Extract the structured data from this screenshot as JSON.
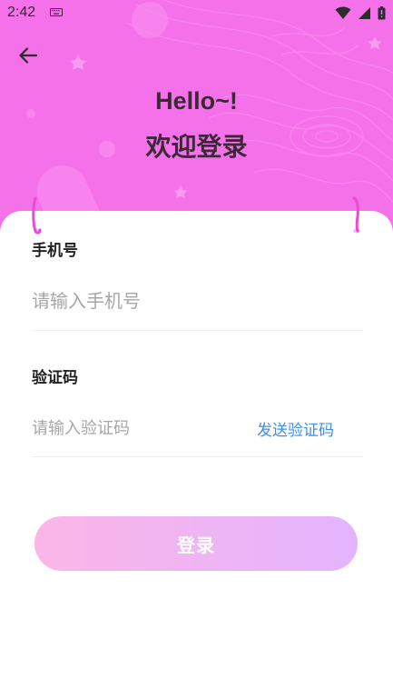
{
  "status_bar": {
    "time": "2:42"
  },
  "header": {
    "greeting": "Hello~!",
    "title": "欢迎登录",
    "back_icon": "arrow-left-icon"
  },
  "form": {
    "phone": {
      "label": "手机号",
      "placeholder": "请输入手机号",
      "value": ""
    },
    "code": {
      "label": "验证码",
      "placeholder": "请输入验证码",
      "value": "",
      "send_label": "发送验证码"
    },
    "submit_label": "登录"
  },
  "colors": {
    "header_bg": "#f571e9",
    "link": "#3e8fe6",
    "button_gradient_start": "#fbb6e7",
    "button_gradient_end": "#e3b4fd"
  }
}
